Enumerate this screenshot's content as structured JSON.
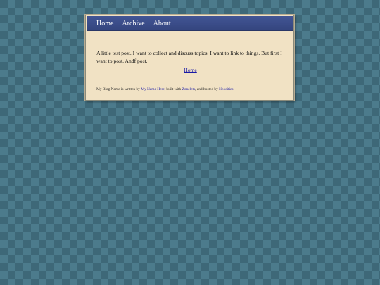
{
  "nav": {
    "items": [
      {
        "label": "Home"
      },
      {
        "label": "Archive"
      },
      {
        "label": "About"
      }
    ]
  },
  "post": {
    "text": "A little test post. I want to collect and discuss topics. I want to link to things. But first I want to post. Andf post.",
    "home_link": "Home"
  },
  "footer": {
    "prefix": "My Blog Name is written by ",
    "author_link": "My Name Here",
    "middle": ", built with ",
    "builder_link": "Zonelets",
    "middle2": ", and hosted by ",
    "host_link": "Neocities",
    "suffix": "!"
  },
  "colors": {
    "background": "#3e6878",
    "pattern": "#4c7b8c",
    "nav": "#3b4d8a",
    "card": "#f1e2c4",
    "link": "#1a1aa6"
  }
}
